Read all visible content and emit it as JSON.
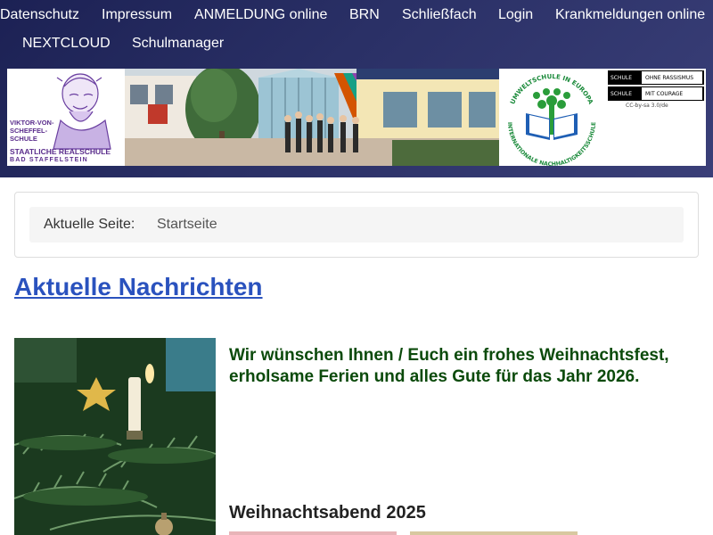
{
  "nav": {
    "items": [
      {
        "label": "Datenschutz"
      },
      {
        "label": "Impressum"
      },
      {
        "label": "ANMELDUNG online"
      },
      {
        "label": "BRN"
      },
      {
        "label": "Schließfach"
      },
      {
        "label": "Login"
      },
      {
        "label": "Krankmeldungen online"
      },
      {
        "label": "NEXTCLOUD"
      },
      {
        "label": "Schulmanager"
      }
    ]
  },
  "banner": {
    "school_logo": {
      "name_lines": [
        "VIKTOR-VON-",
        "SCHEFFEL-",
        "SCHULE"
      ],
      "type": "STAATLICHE REALSCHULE",
      "city": "BAD STAFFELSTEIN"
    },
    "eco_badge": {
      "top_text": "UMWELTSCHULE IN EUROPA",
      "bottom_text": "INTERNATIONALE NACHHALTIGKEITSSCHULE"
    },
    "sor_badge": {
      "row1_left": "SCHULE",
      "row1_right": "OHNE RASSISMUS",
      "row2_left": "SCHULE",
      "row2_right": "MIT COURAGE",
      "license": "CC-by-sa 3.0/de"
    }
  },
  "breadcrumb": {
    "label": "Aktuelle Seite:",
    "current": "Startseite"
  },
  "news": {
    "title": "Aktuelle Nachrichten",
    "greeting": "Wir wünschen Ihnen / Euch ein frohes Weihnachtsfest, erholsame Ferien und alles Gute für das Jahr 2026.",
    "subheading": "Weihnachtsabend 2025"
  },
  "colors": {
    "header_bg": "#2a3066",
    "link": "#2a52be",
    "greeting": "#0b4a0b"
  }
}
